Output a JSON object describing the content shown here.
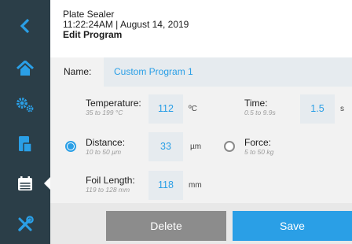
{
  "header": {
    "device": "Plate Sealer",
    "timestamp": "11:22:24AM | August 14, 2019",
    "page": "Edit Program"
  },
  "sidebar": {
    "items": [
      {
        "icon": "chevron-left-icon"
      },
      {
        "icon": "home-icon"
      },
      {
        "icon": "gears-icon"
      },
      {
        "icon": "document-icon"
      },
      {
        "icon": "calendar-icon",
        "active": true
      },
      {
        "icon": "tools-icon"
      }
    ],
    "colors": {
      "background": "#2b3e48",
      "icon": "#2a9fe6",
      "active_icon": "#ffffff"
    }
  },
  "program": {
    "name_label": "Name:",
    "name_value": "Custom Program 1"
  },
  "params": {
    "temperature": {
      "label": "Temperature:",
      "range": "35 to 199 °C",
      "value": "112",
      "unit": "ºC"
    },
    "time": {
      "label": "Time:",
      "range": "0.5 to 9.9s",
      "value": "1.5",
      "unit": "s"
    },
    "distance": {
      "label": "Distance:",
      "range": "10 to 50 µm",
      "value": "33",
      "unit": "µm",
      "selected": true
    },
    "force": {
      "label": "Force:",
      "range": "5 to 50 kg",
      "selected": false
    },
    "foil_length": {
      "label": "Foil Length:",
      "range": "119 to 128 mm",
      "value": "118",
      "unit": "mm"
    }
  },
  "actions": {
    "delete_label": "Delete",
    "save_label": "Save"
  },
  "colors": {
    "accent": "#2a9fe6",
    "delete_button": "#8c8c8c",
    "panel": "#f2f2f2",
    "input": "#e6ebef"
  }
}
